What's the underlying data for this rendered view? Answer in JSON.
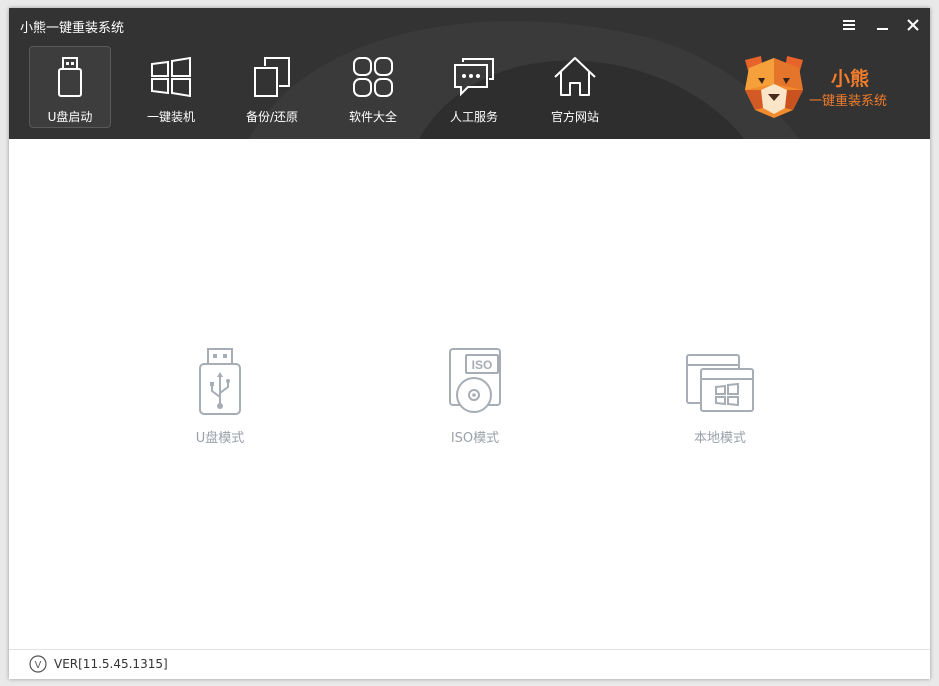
{
  "window": {
    "title": "小熊一键重装系统"
  },
  "nav": {
    "items": [
      {
        "label": "U盘启动",
        "icon": "usb-drive-icon",
        "active": true
      },
      {
        "label": "一键装机",
        "icon": "windows-icon",
        "active": false
      },
      {
        "label": "备份/还原",
        "icon": "copy-icon",
        "active": false
      },
      {
        "label": "软件大全",
        "icon": "apps-grid-icon",
        "active": false
      },
      {
        "label": "人工服务",
        "icon": "chat-bubbles-icon",
        "active": false
      },
      {
        "label": "官方网站",
        "icon": "home-icon",
        "active": false
      }
    ]
  },
  "brand": {
    "name": "小熊",
    "slogan": "一键重装系统",
    "icon": "bear-logo-icon"
  },
  "modes": [
    {
      "label": "U盘模式",
      "icon": "usb-icon"
    },
    {
      "label": "ISO模式",
      "icon": "iso-disc-icon",
      "icon_text": "ISO"
    },
    {
      "label": "本地模式",
      "icon": "local-windows-icon"
    }
  ],
  "footer": {
    "version": "VER[11.5.45.1315]",
    "icon_letter": "V"
  },
  "colors": {
    "header_bg": "#333333",
    "accent": "#f07c2c",
    "mode_icon": "#a6adb4",
    "mode_label": "#9aa1a8"
  }
}
